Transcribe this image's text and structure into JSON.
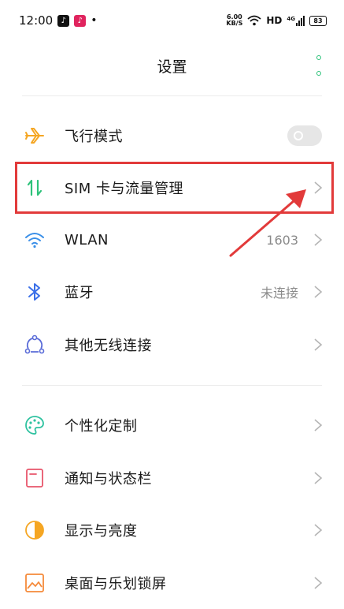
{
  "status_bar": {
    "time": "12:00",
    "dot": "•",
    "net_speed_value": "6.00",
    "net_speed_unit": "KB/S",
    "hd": "HD",
    "signal": "4G",
    "battery": "83"
  },
  "header": {
    "title": "设置"
  },
  "settings": {
    "airplane": {
      "label": "飞行模式"
    },
    "sim": {
      "label": "SIM 卡与流量管理"
    },
    "wlan": {
      "label": "WLAN",
      "value": "1603"
    },
    "bluetooth": {
      "label": "蓝牙",
      "value": "未连接"
    },
    "other_wireless": {
      "label": "其他无线连接"
    },
    "personalize": {
      "label": "个性化定制"
    },
    "notifications": {
      "label": "通知与状态栏"
    },
    "display": {
      "label": "显示与亮度"
    },
    "desktop": {
      "label": "桌面与乐划锁屏"
    }
  },
  "colors": {
    "accent_green": "#2ec27a",
    "annotation_red": "#e23a3a"
  }
}
